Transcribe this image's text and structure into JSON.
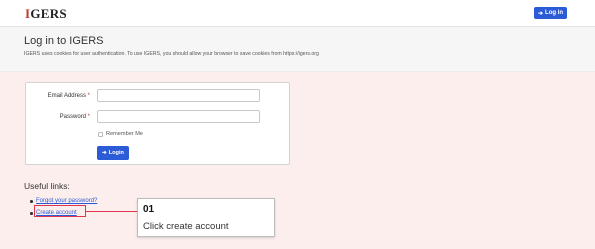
{
  "navbar": {
    "logo_initial": "I",
    "logo_rest": "GERS",
    "login_label": "Log in",
    "login_icon": "sign-in-icon"
  },
  "header": {
    "title": "Log in to IGERS",
    "subtitle": "IGERS uses cookies for user authentication. To use IGERS, you should allow your browser to save cookies from https://igers.org"
  },
  "form": {
    "email_label": "Email Address",
    "password_label": "Password",
    "required_mark": "*",
    "email_value": "",
    "password_value": "",
    "remember_label": "Remember Me",
    "remember_checked": false,
    "submit_label": "Login",
    "submit_icon": "sign-in-icon"
  },
  "links": {
    "heading": "Useful links:",
    "items": [
      {
        "label": "Forgot your password?"
      },
      {
        "label": "Create account"
      }
    ]
  },
  "annotation": {
    "step": "01",
    "text": "Click create account"
  },
  "colors": {
    "accent": "#2c5bd8",
    "background": "#fbeeec",
    "highlight": "#e0334e"
  }
}
